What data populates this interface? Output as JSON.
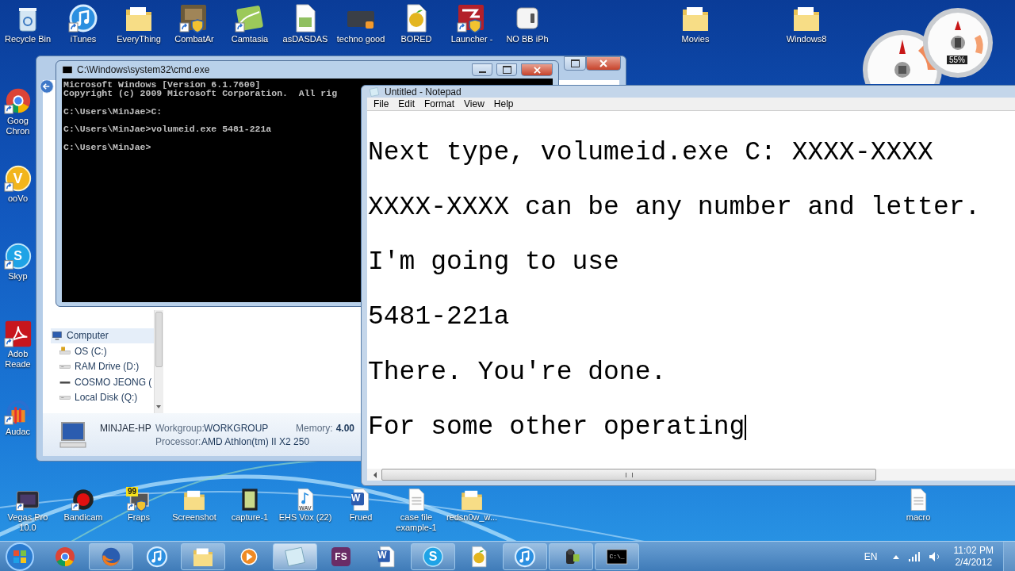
{
  "desktop": {
    "top_icons": [
      {
        "kind": "bin",
        "shortcut": false,
        "lines": [
          "Recycle Bin"
        ]
      },
      {
        "kind": "itunes",
        "shortcut": true,
        "lines": [
          "iTunes"
        ]
      },
      {
        "kind": "folder",
        "shortcut": false,
        "lines": [
          "EveryThing"
        ]
      },
      {
        "kind": "tile",
        "shortcut": true,
        "lines": [
          "CombatAr"
        ]
      },
      {
        "kind": "camtasia",
        "shortcut": true,
        "lines": [
          "Camtasia"
        ]
      },
      {
        "kind": "doc",
        "shortcut": false,
        "lines": [
          "asDASDAS"
        ]
      },
      {
        "kind": "video",
        "shortcut": false,
        "lines": [
          "techno good"
        ]
      },
      {
        "kind": "fl",
        "shortcut": false,
        "lines": [
          "BORED"
        ]
      },
      {
        "kind": "launcher",
        "shortcut": true,
        "lines": [
          "Launcher -"
        ]
      },
      {
        "kind": "cube",
        "shortcut": false,
        "lines": [
          "NO BB iPh"
        ]
      }
    ],
    "top_right_icons": [
      {
        "kind": "folder",
        "shortcut": false,
        "lines": [
          "Movies"
        ]
      },
      {
        "kind": "folder",
        "shortcut": false,
        "lines": [
          "Windows8"
        ]
      }
    ],
    "left_icons": [
      {
        "kind": "chrome",
        "shortcut": true,
        "lines": [
          "Goog",
          "Chron"
        ]
      },
      {
        "kind": "oovoo",
        "shortcut": true,
        "glyph": "V",
        "lines": [
          "ooVo"
        ]
      },
      {
        "kind": "skype",
        "shortcut": true,
        "glyph": "S",
        "lines": [
          "Skyp"
        ]
      },
      {
        "kind": "pdf",
        "shortcut": true,
        "lines": [
          "Adob",
          "Reade"
        ]
      },
      {
        "kind": "audacity",
        "shortcut": true,
        "lines": [
          "Audac"
        ]
      }
    ],
    "bottom_icons": [
      {
        "kind": "vegas",
        "shortcut": true,
        "lines": [
          "Vegas Pro",
          "10.0"
        ]
      },
      {
        "kind": "bandicam",
        "shortcut": true,
        "lines": [
          "Bandicam"
        ]
      },
      {
        "kind": "fraps",
        "shortcut": true,
        "glyph": "99",
        "lines": [
          "Fraps"
        ]
      },
      {
        "kind": "folder",
        "shortcut": false,
        "lines": [
          "Screenshot"
        ]
      },
      {
        "kind": "film",
        "shortcut": false,
        "lines": [
          "capture-1"
        ]
      },
      {
        "kind": "wav",
        "shortcut": false,
        "glyph": "WAV",
        "lines": [
          "EHS Vox (22)"
        ]
      },
      {
        "kind": "word",
        "shortcut": false,
        "glyph": "W",
        "lines": [
          "Frued"
        ]
      },
      {
        "kind": "page",
        "shortcut": false,
        "lines": [
          "case file",
          "example-1"
        ]
      },
      {
        "kind": "folder",
        "shortcut": false,
        "lines": [
          "redsn0w_w..."
        ]
      }
    ],
    "right_bottom_icons": [
      {
        "kind": "page",
        "shortcut": false,
        "lines": [
          "macro"
        ]
      }
    ]
  },
  "gadgets": {
    "reading": "55%"
  },
  "explorer_window": {
    "nav_items": [
      {
        "label": "Computer",
        "kind": "computer",
        "selected": true,
        "children": [
          {
            "label": "OS (C:)",
            "kind": "osdrive",
            "selected": false
          },
          {
            "label": "RAM Drive (D:)",
            "kind": "drive",
            "selected": false
          },
          {
            "label": "COSMO JEONG (",
            "kind": "flat",
            "selected": false
          },
          {
            "label": "Local Disk (Q:)",
            "kind": "drive",
            "selected": false
          }
        ]
      }
    ],
    "details": {
      "computer_name": "MINJAE-HP",
      "workgroup_label": "Workgroup:",
      "workgroup": "WORKGROUP",
      "memory_label": "Memory:",
      "memory": "4.00",
      "processor_label": "Processor:",
      "processor": "AMD Athlon(tm) II X2 250"
    }
  },
  "cmd_window": {
    "title": "C:\\Windows\\system32\\cmd.exe",
    "blocks": [
      [
        "Microsoft Windows [Version 6.1.7600]",
        "Copyright (c) 2009 Microsoft Corporation.  All rig"
      ],
      [
        "C:\\Users\\MinJae>C:"
      ],
      [
        "C:\\Users\\MinJae>volumeid.exe 5481-221a"
      ],
      [
        "C:\\Users\\MinJae>"
      ]
    ]
  },
  "notepad": {
    "title": "Untitled - Notepad",
    "menu": [
      "File",
      "Edit",
      "Format",
      "View",
      "Help"
    ],
    "caret_visible": true,
    "lines": [
      "Next type, volumeid.exe C: XXXX-XXXX",
      "XXXX-XXXX can be any number and letter.",
      "I'm going to use",
      "5481-221a",
      "There. You're done.",
      "For some other operating"
    ]
  },
  "taskbar": {
    "items": [
      {
        "kind": "chrome",
        "open": false,
        "selected": false
      },
      {
        "kind": "firefox",
        "open": true,
        "selected": false
      },
      {
        "kind": "itunes",
        "open": false,
        "selected": false
      },
      {
        "kind": "folder",
        "open": true,
        "selected": false
      },
      {
        "kind": "media",
        "open": false,
        "selected": false
      },
      {
        "kind": "notepad",
        "open": true,
        "selected": true
      },
      {
        "kind": "fs",
        "glyph": "FS",
        "open": false,
        "selected": false
      },
      {
        "kind": "word",
        "glyph": "W",
        "open": false,
        "selected": false
      },
      {
        "kind": "skype",
        "glyph": "S",
        "open": true,
        "selected": false
      },
      {
        "kind": "fl",
        "open": false,
        "selected": false
      },
      {
        "kind": "itunes",
        "open": true,
        "selected": false
      },
      {
        "kind": "camcorder",
        "open": true,
        "selected": false
      },
      {
        "kind": "cmd",
        "glyph": "C:\\_",
        "open": true,
        "selected": false
      }
    ],
    "tray": {
      "language": "EN",
      "time": "11:02 PM",
      "date": "2/4/2012"
    }
  }
}
